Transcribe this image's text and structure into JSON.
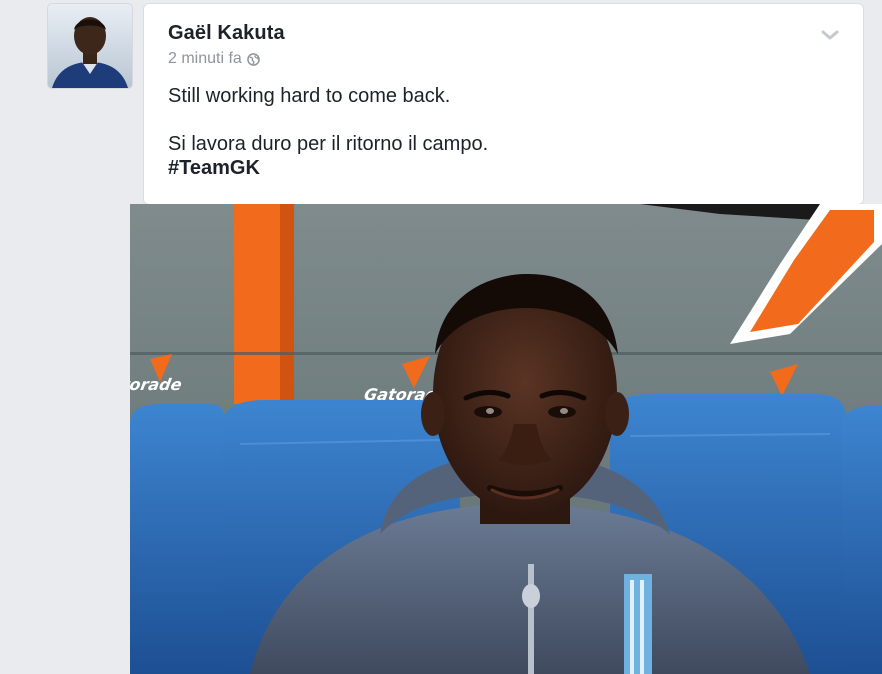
{
  "post": {
    "author": "Gaël Kakuta",
    "timestamp": "2 minuti fa",
    "privacy_icon": "globe-icon",
    "menu_icon": "chevron-down-icon",
    "text_line1": "Still working hard to come back.",
    "text_line2": "Si lavora duro per il ritorno il campo.",
    "hashtag": "#TeamGK"
  },
  "photo": {
    "banner_text": "Gatorade"
  },
  "colors": {
    "background": "#e9ebee",
    "card": "#ffffff",
    "text": "#1d2129",
    "meta": "#90949c",
    "seat_blue": "#2f6fb8",
    "orange": "#f26a1b"
  }
}
